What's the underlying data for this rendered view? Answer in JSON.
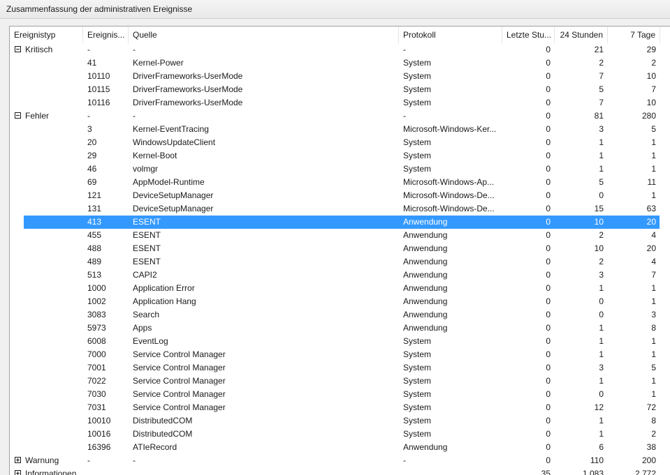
{
  "window": {
    "title": "Zusammenfassung der administrativen Ereignisse"
  },
  "columns": {
    "ereignistyp": "Ereignistyp",
    "ereignis_id": "Ereignis...",
    "quelle": "Quelle",
    "protokoll": "Protokoll",
    "letzte_stunde": "Letzte Stu...",
    "stunden24": "24 Stunden",
    "tage7": "7 Tage"
  },
  "rows": [
    {
      "group": "Kritisch",
      "expanded": true,
      "id": "-",
      "source": "-",
      "log": "-",
      "h1": "0",
      "h24": "21",
      "d7": "29"
    },
    {
      "id": "41",
      "source": "Kernel-Power",
      "log": "System",
      "h1": "0",
      "h24": "2",
      "d7": "2"
    },
    {
      "id": "10110",
      "source": "DriverFrameworks-UserMode",
      "log": "System",
      "h1": "0",
      "h24": "7",
      "d7": "10"
    },
    {
      "id": "10115",
      "source": "DriverFrameworks-UserMode",
      "log": "System",
      "h1": "0",
      "h24": "5",
      "d7": "7"
    },
    {
      "id": "10116",
      "source": "DriverFrameworks-UserMode",
      "log": "System",
      "h1": "0",
      "h24": "7",
      "d7": "10"
    },
    {
      "group": "Fehler",
      "expanded": true,
      "id": "-",
      "source": "-",
      "log": "-",
      "h1": "0",
      "h24": "81",
      "d7": "280"
    },
    {
      "id": "3",
      "source": "Kernel-EventTracing",
      "log": "Microsoft-Windows-Ker...",
      "h1": "0",
      "h24": "3",
      "d7": "5"
    },
    {
      "id": "20",
      "source": "WindowsUpdateClient",
      "log": "System",
      "h1": "0",
      "h24": "1",
      "d7": "1"
    },
    {
      "id": "29",
      "source": "Kernel-Boot",
      "log": "System",
      "h1": "0",
      "h24": "1",
      "d7": "1"
    },
    {
      "id": "46",
      "source": "volmgr",
      "log": "System",
      "h1": "0",
      "h24": "1",
      "d7": "1"
    },
    {
      "id": "69",
      "source": "AppModel-Runtime",
      "log": "Microsoft-Windows-Ap...",
      "h1": "0",
      "h24": "5",
      "d7": "11"
    },
    {
      "id": "121",
      "source": "DeviceSetupManager",
      "log": "Microsoft-Windows-De...",
      "h1": "0",
      "h24": "0",
      "d7": "1"
    },
    {
      "id": "131",
      "source": "DeviceSetupManager",
      "log": "Microsoft-Windows-De...",
      "h1": "0",
      "h24": "15",
      "d7": "63"
    },
    {
      "id": "413",
      "source": "ESENT",
      "log": "Anwendung",
      "h1": "0",
      "h24": "10",
      "d7": "20",
      "selected": true
    },
    {
      "id": "455",
      "source": "ESENT",
      "log": "Anwendung",
      "h1": "0",
      "h24": "2",
      "d7": "4"
    },
    {
      "id": "488",
      "source": "ESENT",
      "log": "Anwendung",
      "h1": "0",
      "h24": "10",
      "d7": "20"
    },
    {
      "id": "489",
      "source": "ESENT",
      "log": "Anwendung",
      "h1": "0",
      "h24": "2",
      "d7": "4"
    },
    {
      "id": "513",
      "source": "CAPI2",
      "log": "Anwendung",
      "h1": "0",
      "h24": "3",
      "d7": "7"
    },
    {
      "id": "1000",
      "source": "Application Error",
      "log": "Anwendung",
      "h1": "0",
      "h24": "1",
      "d7": "1"
    },
    {
      "id": "1002",
      "source": "Application Hang",
      "log": "Anwendung",
      "h1": "0",
      "h24": "0",
      "d7": "1"
    },
    {
      "id": "3083",
      "source": "Search",
      "log": "Anwendung",
      "h1": "0",
      "h24": "0",
      "d7": "3"
    },
    {
      "id": "5973",
      "source": "Apps",
      "log": "Anwendung",
      "h1": "0",
      "h24": "1",
      "d7": "8"
    },
    {
      "id": "6008",
      "source": "EventLog",
      "log": "System",
      "h1": "0",
      "h24": "1",
      "d7": "1"
    },
    {
      "id": "7000",
      "source": "Service Control Manager",
      "log": "System",
      "h1": "0",
      "h24": "1",
      "d7": "1"
    },
    {
      "id": "7001",
      "source": "Service Control Manager",
      "log": "System",
      "h1": "0",
      "h24": "3",
      "d7": "5"
    },
    {
      "id": "7022",
      "source": "Service Control Manager",
      "log": "System",
      "h1": "0",
      "h24": "1",
      "d7": "1"
    },
    {
      "id": "7030",
      "source": "Service Control Manager",
      "log": "System",
      "h1": "0",
      "h24": "0",
      "d7": "1"
    },
    {
      "id": "7031",
      "source": "Service Control Manager",
      "log": "System",
      "h1": "0",
      "h24": "12",
      "d7": "72"
    },
    {
      "id": "10010",
      "source": "DistributedCOM",
      "log": "System",
      "h1": "0",
      "h24": "1",
      "d7": "8"
    },
    {
      "id": "10016",
      "source": "DistributedCOM",
      "log": "System",
      "h1": "0",
      "h24": "1",
      "d7": "2"
    },
    {
      "id": "16396",
      "source": "ATIeRecord",
      "log": "Anwendung",
      "h1": "0",
      "h24": "6",
      "d7": "38"
    },
    {
      "group": "Warnung",
      "expanded": false,
      "id": "-",
      "source": "-",
      "log": "-",
      "h1": "0",
      "h24": "110",
      "d7": "200"
    },
    {
      "group": "Informationen",
      "expanded": false,
      "id": "",
      "source": "",
      "log": "",
      "h1": "35",
      "h24": "1.083",
      "d7": "2.772"
    }
  ]
}
